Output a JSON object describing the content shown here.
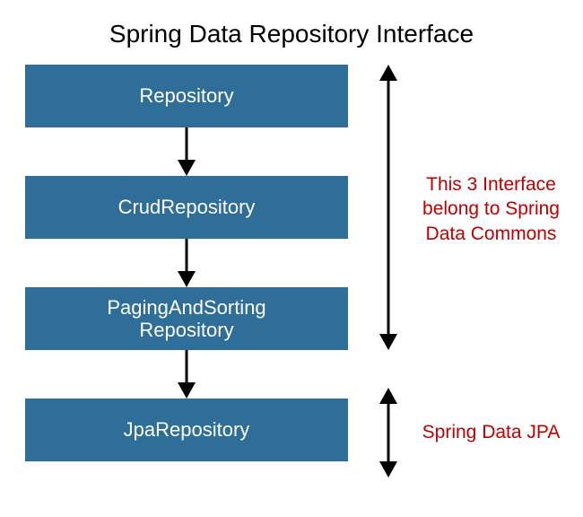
{
  "title": "Spring Data Repository Interface",
  "boxes": {
    "b1": "Repository",
    "b2": "CrudRepository",
    "b3_line1": "PagingAndSorting",
    "b3_line2": "Repository",
    "b4": "JpaRepository"
  },
  "annotations": {
    "a1_line1": "This 3 Interface",
    "a1_line2": "belong to Spring",
    "a1_line3": "Data Commons",
    "a2": "Spring Data JPA"
  },
  "colors": {
    "box_bg": "#2e6e98",
    "annotation": "#c00000"
  }
}
